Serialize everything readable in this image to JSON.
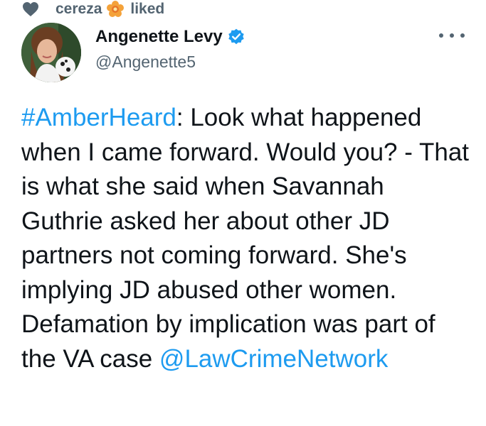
{
  "social_context": {
    "user": "cereza",
    "action": "liked",
    "icon": "heart-icon",
    "user_badge_icon": "flower-badge-icon"
  },
  "author": {
    "display_name": "Angenette Levy",
    "handle": "@Angenette5",
    "verified_icon": "verified-badge-icon"
  },
  "menu": {
    "icon": "more-options-icon"
  },
  "tweet": {
    "hashtag": "#AmberHeard",
    "text_main": ": Look what happened when I came forward. Would you? - That is what she said when Savannah Guthrie asked her about other JD partners not coming forward. She's implying JD abused other women. Defamation by implication was part of the VA case ",
    "mention": "@LawCrimeNetwork"
  },
  "colors": {
    "accent": "#1d9bf0",
    "secondary_text": "#536471",
    "primary_text": "#0f1419"
  }
}
